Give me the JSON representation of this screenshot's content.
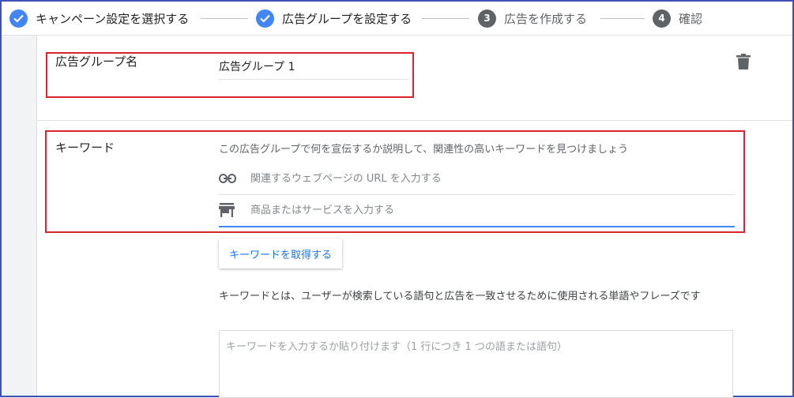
{
  "stepper": {
    "steps": [
      {
        "number": "✓",
        "label": "キャンペーン設定を選択する"
      },
      {
        "number": "✓",
        "label": "広告グループを設定する"
      },
      {
        "number": "3",
        "label": "広告を作成する"
      },
      {
        "number": "4",
        "label": "確認"
      }
    ]
  },
  "ad_group": {
    "name_label": "広告グループ名",
    "name_value": "広告グループ 1"
  },
  "keywords": {
    "label": "キーワード",
    "hint": "この広告グループで何を宣伝するか説明して、関連性の高いキーワードを見つけましょう",
    "url_placeholder": "関連するウェブページの URL を入力する",
    "product_placeholder": "商品またはサービスを入力する",
    "get_button": "キーワードを取得する",
    "description": "キーワードとは、ユーザーが検索している語句と広告を一致させるために使用される単語やフレーズです",
    "textarea_placeholder": "キーワードを入力するか貼り付けます（1 行につき 1 つの語または語句）"
  },
  "colors": {
    "accent": "#4285f4",
    "highlight": "#d9232d",
    "frame": "#3f51b5"
  }
}
